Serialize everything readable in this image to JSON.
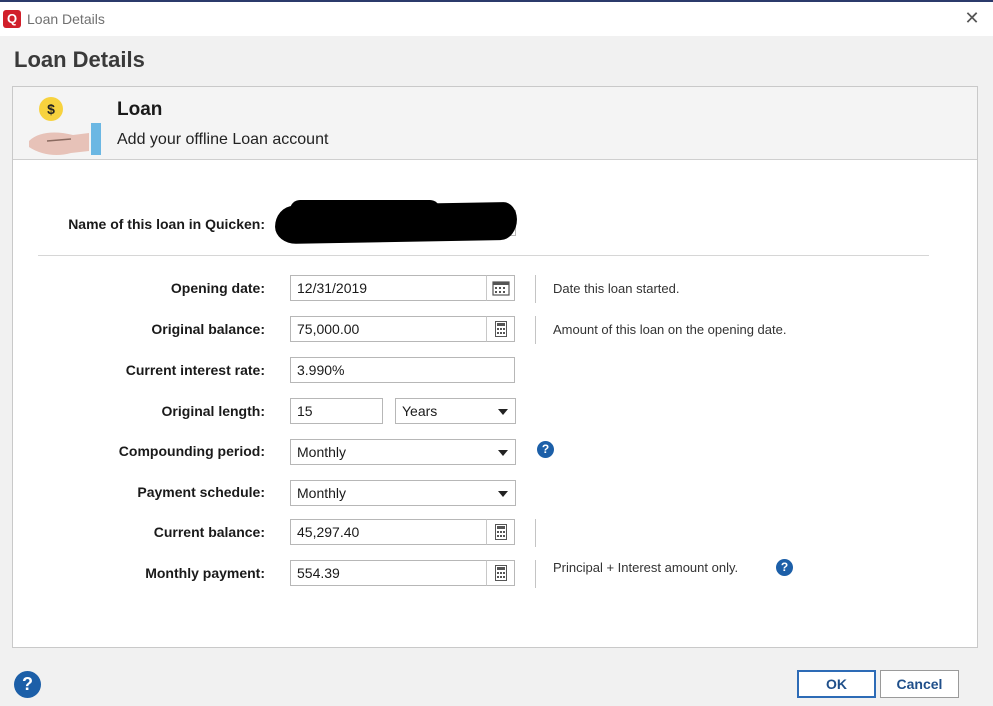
{
  "window": {
    "title": "Loan Details",
    "app_icon_letter": "Q"
  },
  "page_title": "Loan Details",
  "header": {
    "title": "Loan",
    "subtitle": "Add your offline Loan account",
    "dollar": "$"
  },
  "form": {
    "name_label": "Name of this loan in Quicken:",
    "opening_date": {
      "label": "Opening date:",
      "value": "12/31/2019",
      "hint": "Date this loan started."
    },
    "original_balance": {
      "label": "Original balance:",
      "value": "75,000.00",
      "hint": "Amount of this loan on the opening date."
    },
    "interest_rate": {
      "label": "Current interest rate:",
      "value": "3.990%"
    },
    "original_length": {
      "label": "Original length:",
      "value": "15",
      "unit": "Years"
    },
    "compounding_period": {
      "label": "Compounding period:",
      "value": "Monthly"
    },
    "payment_schedule": {
      "label": "Payment schedule:",
      "value": "Monthly"
    },
    "current_balance": {
      "label": "Current balance:",
      "value": "45,297.40"
    },
    "monthly_payment": {
      "label": "Monthly payment:",
      "value": "554.39",
      "hint": "Principal + Interest amount only."
    }
  },
  "buttons": {
    "ok": "OK",
    "cancel": "Cancel"
  },
  "icons": {
    "help": "?",
    "close": "✕"
  },
  "colors": {
    "brand_red": "#d11f2a",
    "help_blue": "#1c5fa8",
    "link_blue": "#1f4f8a"
  }
}
